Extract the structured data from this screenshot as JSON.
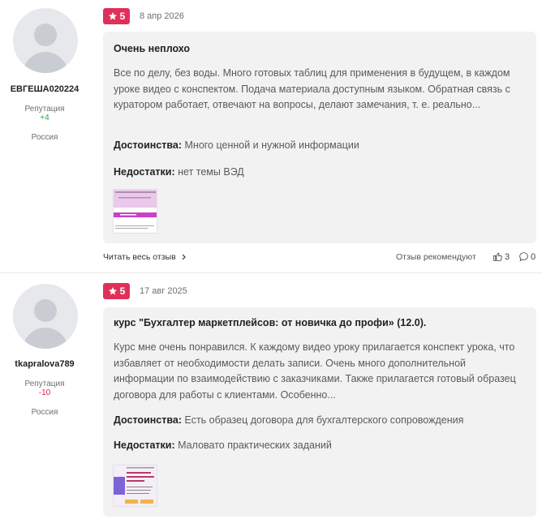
{
  "reviews": [
    {
      "author": {
        "name": "ЕВГЕША020224",
        "reputation_label": "Репутация",
        "reputation_value": "+4",
        "country": "Россия"
      },
      "rating": "5",
      "date": "8 апр 2026",
      "title": "Очень неплохо",
      "text": "Все по делу, без воды. Много готовых таблиц для применения в будущем, в каждом уроке видео с конспектом. Подача материала доступным языком. Обратная связь с куратором работает, отвечают на вопросы, делают замечания, т. е. реально...",
      "pros_label": "Достоинства:",
      "pros": "Много ценной и нужной информации",
      "cons_label": "Недостатки:",
      "cons": "нет темы ВЭД",
      "read_more": "Читать весь отзыв",
      "recommend": "Отзыв рекомендуют",
      "likes": "3",
      "comments": "0"
    },
    {
      "author": {
        "name": "tkapralova789",
        "reputation_label": "Репутация",
        "reputation_value": "-10",
        "country": "Россия"
      },
      "rating": "5",
      "date": "17 авг 2025",
      "title": "курс \"Бухгалтер маркетплейсов: от новичка до профи» (12.0).",
      "text": "Курс мне очень понравился. К каждому видео уроку прилагается конспект урока, что избавляет от необходимости делать записи. Очень много дополнительной информации по взаимодействию с заказчиками. Также прилагается готовый образец договора для работы с клиентами. Особенно...",
      "pros_label": "Достоинства:",
      "pros": "Есть образец договора для бухгалтерского сопровождения",
      "cons_label": "Недостатки:",
      "cons": "Маловато практических заданий"
    }
  ],
  "colors": {
    "badge": "#e0305a",
    "card_bg": "#f2f2f2",
    "rep_positive": "#2ea44f",
    "rep_negative": "#d6284d"
  }
}
